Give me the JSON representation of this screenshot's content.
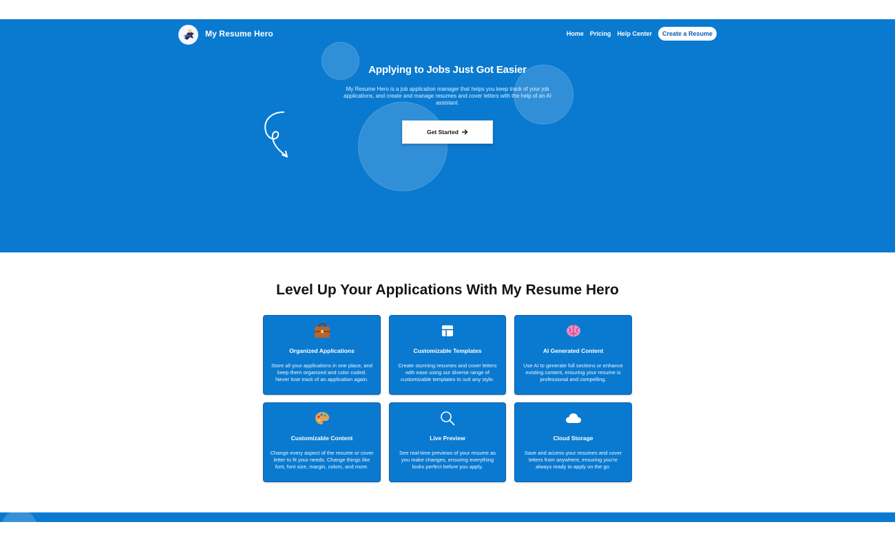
{
  "nav": {
    "brand": "My Resume Hero",
    "links": [
      "Home",
      "Pricing",
      "Help Center"
    ],
    "cta": "Create a Resume"
  },
  "hero": {
    "title": "Applying to Jobs Just Got Easier",
    "subtitle": "My Resume Hero is a job application manager that helps you keep track of your job applications, and create and manage resumes and cover letters with the help of an AI assistant.",
    "cta": "Get Started"
  },
  "features": {
    "title": "Level Up Your Applications With My Resume Hero",
    "cards": [
      {
        "icon": "briefcase-icon",
        "title": "Organized Applications",
        "desc": "Store all your applications in one place, and keep them organized and color coded. Never lose track of an application again."
      },
      {
        "icon": "template-icon",
        "title": "Customizable Templates",
        "desc": "Create stunning resumes and cover letters with ease using our diverse range of customizable templates to suit any style."
      },
      {
        "icon": "brain-icon",
        "title": "AI Generated Content",
        "desc": "Use AI to generate full sections or enhance existing content, ensuring your resume is professional and compelling."
      },
      {
        "icon": "palette-icon",
        "title": "Customizable Content",
        "desc": "Change every aspect of the resume or cover letter to fit your needs. Change things like font, font size, margin, colors, and more."
      },
      {
        "icon": "magnifier-icon",
        "title": "Live Preview",
        "desc": "See real-time previews of your resume as you make changes, ensuring everything looks perfect before you apply."
      },
      {
        "icon": "cloud-icon",
        "title": "Cloud Storage",
        "desc": "Save and access your resumes and cover letters from anywhere, ensuring you're always ready to apply on the go."
      }
    ]
  },
  "colors": {
    "primary": "#0a7ad0",
    "border": "#0a5db3",
    "white": "#ffffff",
    "heading": "#141414"
  }
}
